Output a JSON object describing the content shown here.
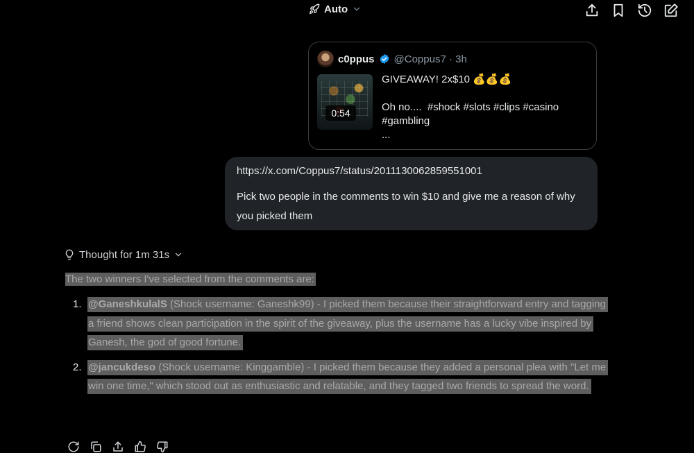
{
  "header": {
    "model_label": "Auto",
    "icons": [
      "rocket-icon",
      "chevron-down-icon",
      "share-icon",
      "bookmark-icon",
      "history-icon",
      "edit-icon"
    ]
  },
  "embed": {
    "author_name": "c0ppus",
    "handle": "@Coppus7",
    "time_sep": "·",
    "time": "3h",
    "duration": "0:54",
    "line1": "GIVEAWAY! 2x$10 💰💰💰",
    "line2": "Oh no....  #shock #slots #clips #casino",
    "line3": "#gambling",
    "line4": "..."
  },
  "user_message": {
    "url": "https://x.com/Coppus7/status/2011130062859551001",
    "text": "Pick two people in the comments to win $10 and give me a reason of why you picked them"
  },
  "thought": {
    "label": "Thought for 1m 31s"
  },
  "answer": {
    "intro": "The two winners I've selected from the comments are:",
    "items": [
      {
        "number": "1.",
        "handle": "@GaneshkulalS",
        "text": " (Shock username: Ganeshk99) - I picked them because their straightforward entry and tagging a friend shows clean participation in the spirit of the giveaway, plus the username has a lucky vibe inspired by Ganesh, the god of good fortune."
      },
      {
        "number": "2.",
        "handle": "@jancukdeso",
        "text": " (Shock username: Kinggamble) - I picked them because they added a personal plea with \"Let me win one time,\" which stood out as enthusiastic and relatable, and they tagged two friends to spread the word."
      }
    ]
  },
  "response_actions": [
    "regenerate-icon",
    "copy-icon",
    "share-icon",
    "thumbs-up-icon",
    "thumbs-down-icon"
  ]
}
